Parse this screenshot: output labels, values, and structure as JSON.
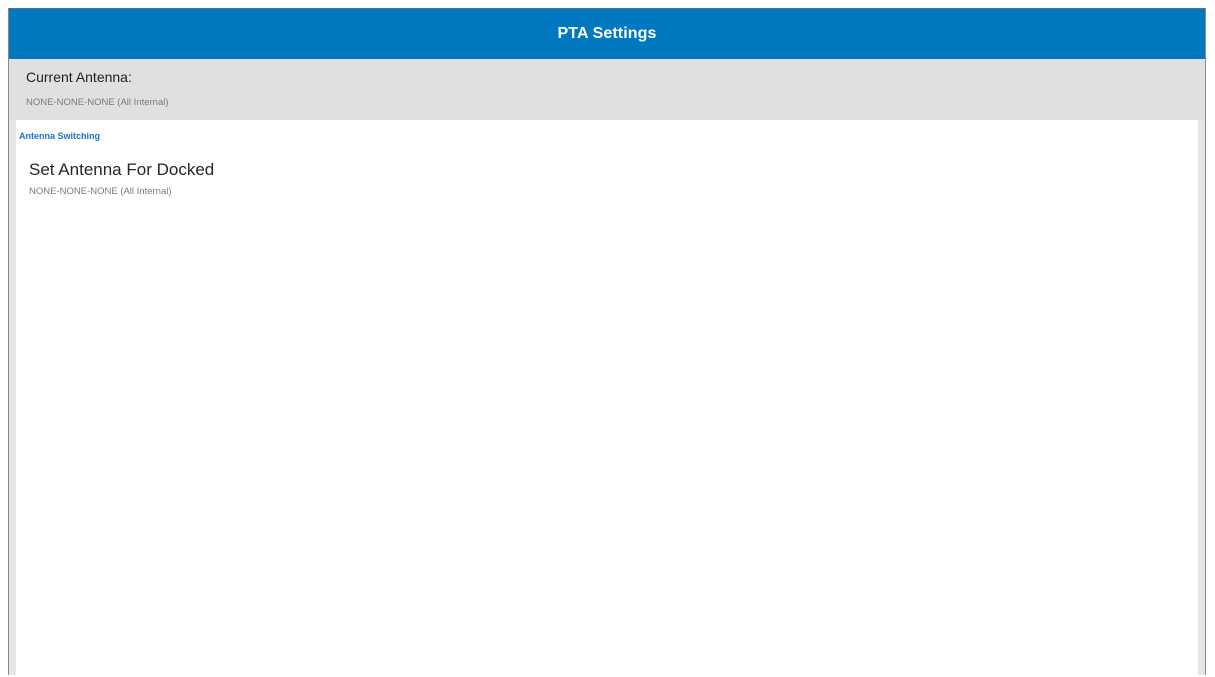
{
  "app_bar": {
    "title": "PTA Settings"
  },
  "current_antenna": {
    "label": "Current Antenna:",
    "value": "NONE-NONE-NONE (All Internal)"
  },
  "antenna_switching": {
    "category_title": "Antenna Switching",
    "items": [
      {
        "title": "Set Antenna For Docked",
        "summary": "NONE-NONE-NONE (All Internal)"
      }
    ]
  },
  "colors": {
    "app_bar_bg": "#0079c1",
    "category_accent": "#1a73c8",
    "status_section_bg": "#e0e0e0"
  }
}
